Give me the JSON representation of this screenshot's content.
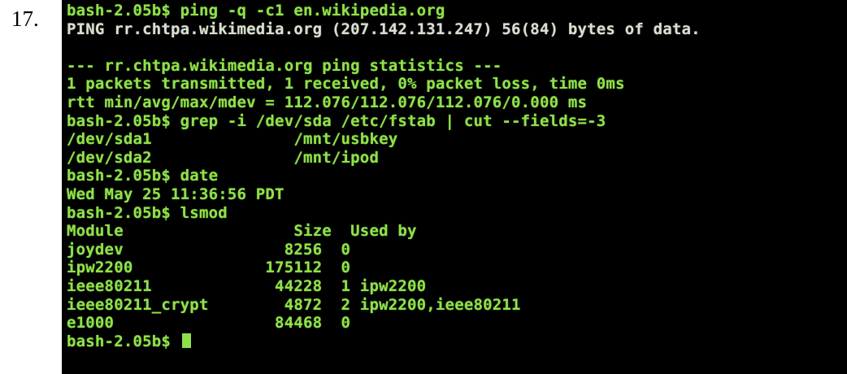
{
  "item_number": "17.",
  "colors": {
    "terminal_bg": "#000000",
    "prompt_text": "#8fe04a",
    "output_text": "#8fe04a",
    "accent_text": "#d8dfcf"
  },
  "terminal": {
    "lines": [
      "bash-2.05b$ ping -q -c1 en.wikipedia.org",
      "PING rr.chtpa.wikimedia.org (207.142.131.247) 56(84) bytes of data.",
      "",
      "--- rr.chtpa.wikimedia.org ping statistics ---",
      "1 packets transmitted, 1 received, 0% packet loss, time 0ms",
      "rtt min/avg/max/mdev = 112.076/112.076/112.076/0.000 ms",
      "bash-2.05b$ grep -i /dev/sda /etc/fstab | cut --fields=-3",
      "/dev/sda1               /mnt/usbkey",
      "/dev/sda2               /mnt/ipod",
      "bash-2.05b$ date",
      "Wed May 25 11:36:56 PDT",
      "bash-2.05b$ lsmod",
      "Module                  Size  Used by",
      "joydev                 8256  0",
      "ipw2200              175112  0",
      "ieee80211             44228  1 ipw2200",
      "ieee80211_crypt        4872  2 ipw2200,ieee80211",
      "e1000                 84468  0"
    ],
    "current_prompt": "bash-2.05b$ "
  }
}
